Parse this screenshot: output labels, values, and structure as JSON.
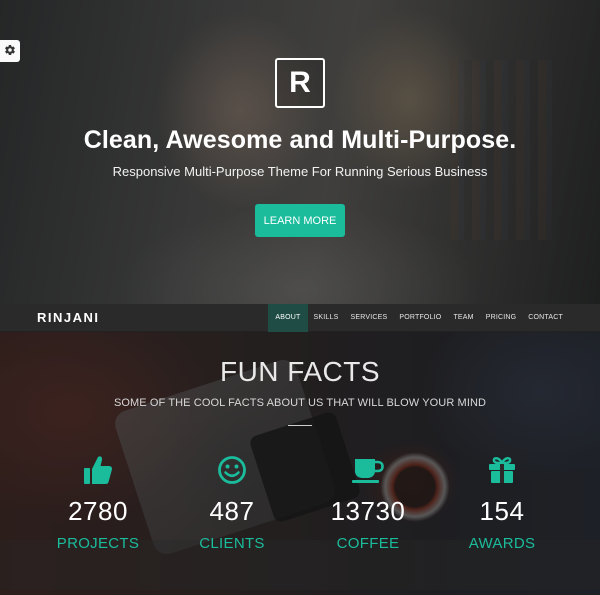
{
  "hero": {
    "logo_letter": "R",
    "title": "Clean, Awesome and Multi-Purpose.",
    "subtitle": "Responsive Multi-Purpose Theme For Running Serious Business",
    "cta_label": "LEARN MORE",
    "settings_icon": "gear-icon"
  },
  "navbar": {
    "brand": "RINJANI",
    "items": [
      {
        "label": "ABOUT",
        "active": true
      },
      {
        "label": "SKILLS",
        "active": false
      },
      {
        "label": "SERVICES",
        "active": false
      },
      {
        "label": "PORTFOLIO",
        "active": false
      },
      {
        "label": "TEAM",
        "active": false
      },
      {
        "label": "PRICING",
        "active": false
      },
      {
        "label": "CONTACT",
        "active": false
      }
    ]
  },
  "facts": {
    "title": "FUN FACTS",
    "subtitle": "SOME OF THE COOL FACTS ABOUT US THAT WILL BLOW YOUR MIND",
    "stats": [
      {
        "icon": "thumbs-up-icon",
        "number": "2780",
        "label": "PROJECTS"
      },
      {
        "icon": "smiley-icon",
        "number": "487",
        "label": "CLIENTS"
      },
      {
        "icon": "coffee-cup-icon",
        "number": "13730",
        "label": "COFFEE"
      },
      {
        "icon": "gift-icon",
        "number": "154",
        "label": "AWARDS"
      }
    ]
  },
  "colors": {
    "accent": "#1abc9c",
    "nav_active": "#1f4d45",
    "navbar_bg": "#2a2a2a"
  }
}
